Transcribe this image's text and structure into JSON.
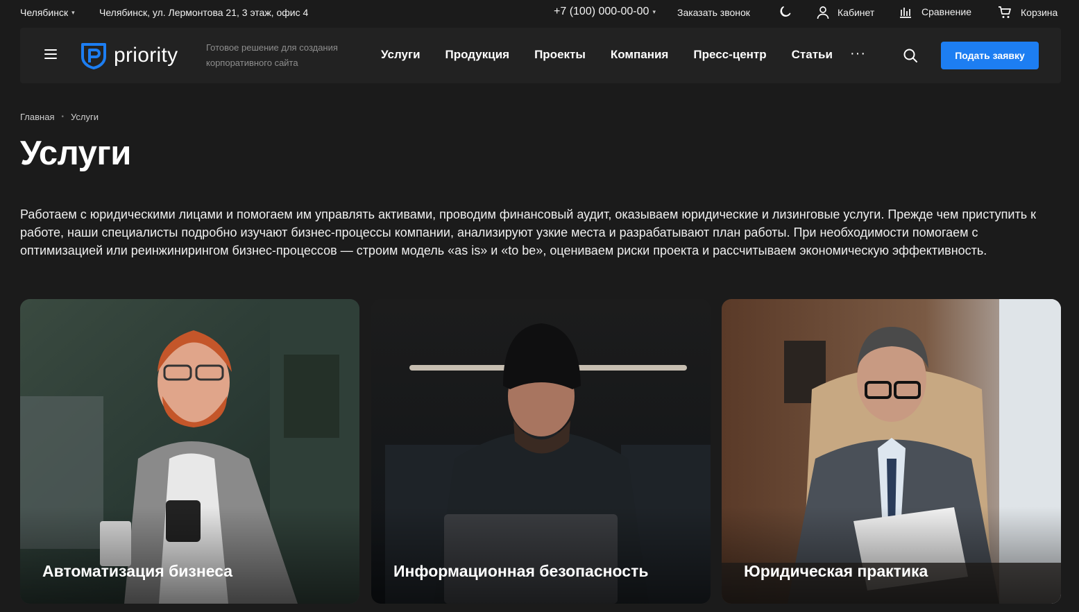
{
  "topbar": {
    "city": "Челябинск",
    "address": "Челябинск, ул. Лермонтова 21, 3 этаж, офис 4",
    "phone": "+7 (100) 000-00-00",
    "callback": "Заказать звонок",
    "cabinet": "Кабинет",
    "compare": "Сравнение",
    "cart": "Корзина"
  },
  "header": {
    "logo": "priority",
    "tagline": "Готовое решение для создания корпоративного сайта",
    "nav": [
      "Услуги",
      "Продукция",
      "Проекты",
      "Компания",
      "Пресс-центр",
      "Статьи"
    ],
    "more": "···",
    "cta": "Подать заявку"
  },
  "breadcrumb": [
    "Главная",
    "Услуги"
  ],
  "page": {
    "title": "Услуги",
    "intro": "Работаем с юридическими лицами и помогаем им управлять активами, проводим финансовый аудит, оказываем юридические и лизинговые услуги. Прежде чем приступить к работе, наши специалисты подробно изучают бизнес-процессы компании, анализируют узкие места и разрабатывают план работы. При необходимости помогаем с оптимизацией или реинжинирингом бизнес-процессов — строим модель «as is» и «to be», оцениваем риски проекта и рассчитываем экономическую эффективность."
  },
  "cards": [
    {
      "title": "Автоматизация бизнеса"
    },
    {
      "title": "Информационная безопасность"
    },
    {
      "title": "Юридическая практика"
    }
  ],
  "colors": {
    "accent": "#1d7ef2",
    "background": "#1b1b1b",
    "header_bg": "#222222"
  }
}
